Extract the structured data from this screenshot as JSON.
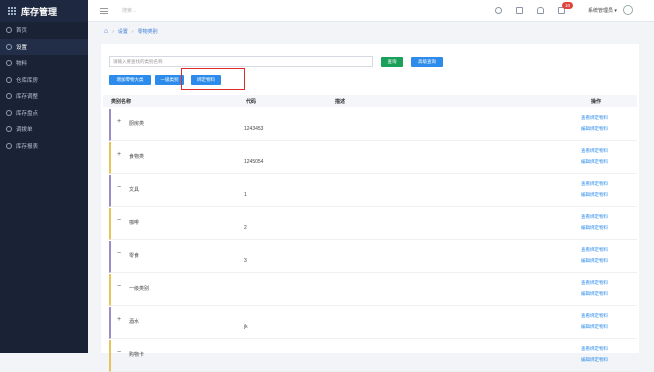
{
  "app": {
    "title": "库存管理"
  },
  "sidebar": {
    "items": [
      {
        "label": "首页",
        "icon": "home-icon",
        "active": false
      },
      {
        "label": "设置",
        "icon": "gear-icon",
        "active": true
      },
      {
        "label": "物料",
        "icon": "box-icon",
        "active": false
      },
      {
        "label": "仓库库房",
        "icon": "warehouse-icon",
        "active": false
      },
      {
        "label": "库存调整",
        "icon": "adjust-icon",
        "active": false
      },
      {
        "label": "库存盘点",
        "icon": "clipboard-icon",
        "active": false
      },
      {
        "label": "调拨单",
        "icon": "transfer-icon",
        "active": false
      },
      {
        "label": "库存报表",
        "icon": "report-icon",
        "active": false
      }
    ]
  },
  "topbar": {
    "search_placeholder": "搜索...",
    "badge": "10",
    "user": "系统管理员 ▾"
  },
  "breadcrumb": {
    "items": [
      "设置",
      "零物类别"
    ]
  },
  "toolbar": {
    "query_placeholder": "请输入要查找的类别名称",
    "query_label": "查询",
    "advanced_label": "高级查询",
    "btn_category": "增加零物大类",
    "btn_sub": "一级类别",
    "btn_bind": "绑定物料"
  },
  "table": {
    "headers": [
      "类别名称",
      "代码",
      "描述",
      "操作"
    ],
    "rows": [
      {
        "toggle": "+",
        "name": "厨房类",
        "code": "1243453",
        "action1": "查看绑定物料",
        "action2": "编辑绑定物料",
        "color": "#9c8ec4"
      },
      {
        "toggle": "+",
        "name": "食物类",
        "code": "1245054",
        "action1": "查看绑定物料",
        "action2": "编辑绑定物料",
        "color": "#e8c35c"
      },
      {
        "toggle": "−",
        "name": "文具",
        "code": "1",
        "action1": "查看绑定物料",
        "action2": "编辑绑定物料",
        "color": "#9c8ec4"
      },
      {
        "toggle": "−",
        "name": "咖啡",
        "code": "2",
        "action1": "查看绑定物料",
        "action2": "编辑绑定物料",
        "color": "#e8c35c"
      },
      {
        "toggle": "−",
        "name": "零食",
        "code": "3",
        "action1": "查看绑定物料",
        "action2": "编辑绑定物料",
        "color": "#9c8ec4"
      },
      {
        "toggle": "−",
        "name": "一级类别",
        "code": "",
        "action1": "查看绑定物料",
        "action2": "编辑绑定物料",
        "color": "#e8c35c"
      },
      {
        "toggle": "+",
        "name": "酒水",
        "code": "jk",
        "action1": "查看绑定物料",
        "action2": "编辑绑定物料",
        "color": "#9c8ec4"
      },
      {
        "toggle": "−",
        "name": "购物卡",
        "code": "",
        "action1": "查看绑定物料",
        "action2": "编辑绑定物料",
        "color": "#e8c35c"
      }
    ]
  }
}
